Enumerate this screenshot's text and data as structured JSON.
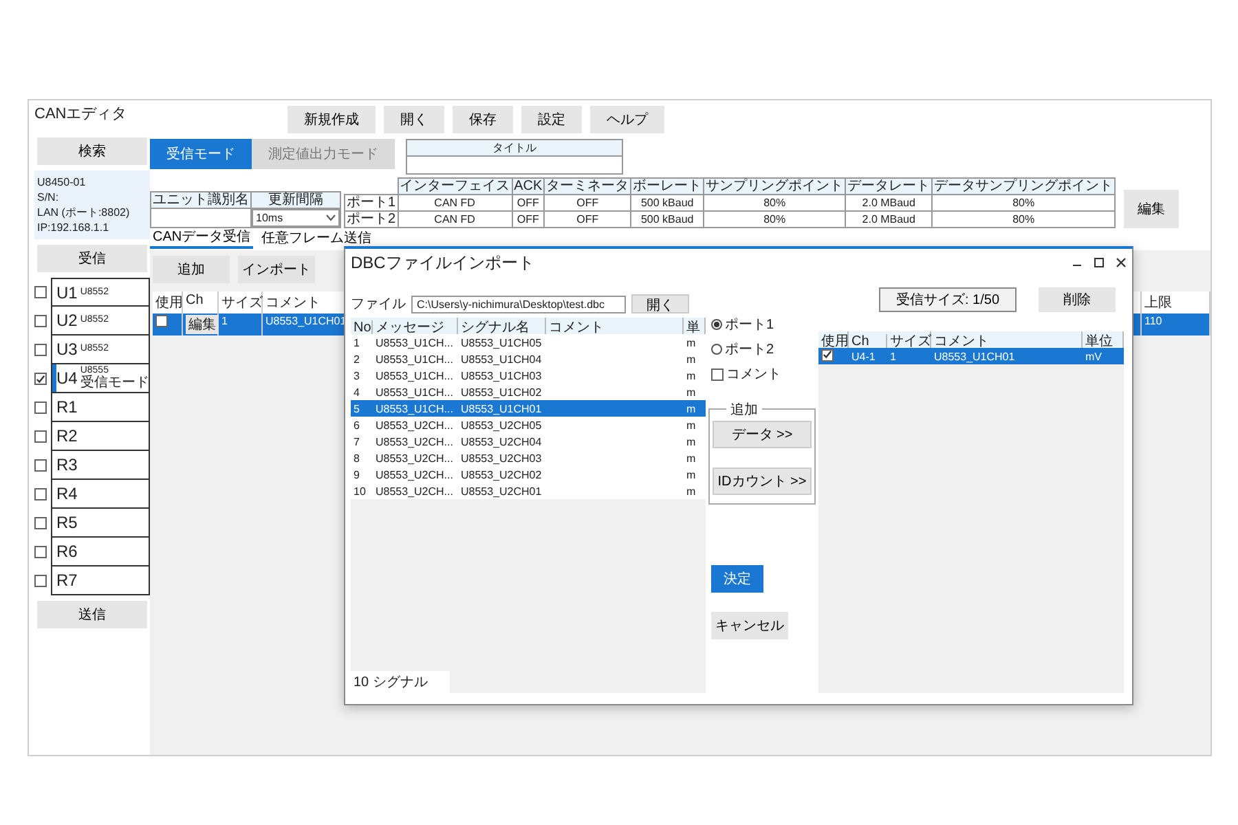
{
  "app": {
    "title": "CANエディタ"
  },
  "sidebar": {
    "search_button": "検索",
    "device_info": [
      "U8450-01",
      "S/N:",
      "LAN (ポート:8802)",
      "IP:192.168.1.1"
    ],
    "receive_button": "受信",
    "units": [
      {
        "name": "U1",
        "model": "U8552",
        "checked": false,
        "selected": false
      },
      {
        "name": "U2",
        "model": "U8552",
        "checked": false,
        "selected": false
      },
      {
        "name": "U3",
        "model": "U8552",
        "checked": false,
        "selected": false
      },
      {
        "name": "U4",
        "model": "U8555",
        "mode": "受信モード",
        "checked": true,
        "selected": true
      },
      {
        "name": "R1",
        "checked": false,
        "selected": false
      },
      {
        "name": "R2",
        "checked": false,
        "selected": false
      },
      {
        "name": "R3",
        "checked": false,
        "selected": false
      },
      {
        "name": "R4",
        "checked": false,
        "selected": false
      },
      {
        "name": "R5",
        "checked": false,
        "selected": false
      },
      {
        "name": "R6",
        "checked": false,
        "selected": false
      },
      {
        "name": "R7",
        "checked": false,
        "selected": false
      }
    ],
    "send_button": "送信"
  },
  "toolbar": [
    "新規作成",
    "開く",
    "保存",
    "設定",
    "ヘルプ"
  ],
  "mode_tabs": [
    {
      "label": "受信モード",
      "selected": true
    },
    {
      "label": "測定値出力モード",
      "selected": false
    }
  ],
  "title_field": {
    "label": "タイトル"
  },
  "unit_settings": {
    "columns": [
      "ユニット識別名",
      "更新間隔"
    ],
    "interval": "10ms"
  },
  "ports": {
    "columns": [
      "インターフェイス",
      "ACK",
      "ターミネータ",
      "ボーレート",
      "サンプリングポイント",
      "データレート",
      "データサンプリングポイント"
    ],
    "rows": [
      {
        "port": "ポート1",
        "cells": [
          "CAN FD",
          "OFF",
          "OFF",
          "500 kBaud",
          "80%",
          "2.0 MBaud",
          "80%"
        ]
      },
      {
        "port": "ポート2",
        "cells": [
          "CAN FD",
          "OFF",
          "OFF",
          "500 kBaud",
          "80%",
          "2.0 MBaud",
          "80%"
        ]
      }
    ],
    "edit_button": "編集"
  },
  "data_tabs": [
    {
      "label": "CANデータ受信",
      "selected": true
    },
    {
      "label": "任意フレーム送信",
      "selected": false
    }
  ],
  "actions": [
    "追加",
    "インポート"
  ],
  "channel_table": {
    "columns": [
      "使用",
      "Ch",
      "サイズ",
      "コメント"
    ],
    "right_column": "上限",
    "rows": [
      {
        "used": false,
        "ch_button": "編集",
        "size": "1",
        "comment": "U8553_U1CH01",
        "limit": "110",
        "selected": true
      }
    ]
  },
  "dialog": {
    "title": "DBCファイルインポート",
    "file_label": "ファイル",
    "file_path": "C:\\Users\\y-nichimura\\Desktop\\test.dbc",
    "open_button": "開く",
    "columns": [
      "No",
      "メッセージ",
      "シグナル名",
      "コメント",
      "単"
    ],
    "signals": [
      {
        "no": "1",
        "message": "U8553_U1CH...",
        "signal": "U8553_U1CH05",
        "unit": "m",
        "selected": false
      },
      {
        "no": "2",
        "message": "U8553_U1CH...",
        "signal": "U8553_U1CH04",
        "unit": "m",
        "selected": false
      },
      {
        "no": "3",
        "message": "U8553_U1CH...",
        "signal": "U8553_U1CH03",
        "unit": "m",
        "selected": false
      },
      {
        "no": "4",
        "message": "U8553_U1CH...",
        "signal": "U8553_U1CH02",
        "unit": "m",
        "selected": false
      },
      {
        "no": "5",
        "message": "U8553_U1CH...",
        "signal": "U8553_U1CH01",
        "unit": "m",
        "selected": true
      },
      {
        "no": "6",
        "message": "U8553_U2CH...",
        "signal": "U8553_U2CH05",
        "unit": "m",
        "selected": false
      },
      {
        "no": "7",
        "message": "U8553_U2CH...",
        "signal": "U8553_U2CH04",
        "unit": "m",
        "selected": false
      },
      {
        "no": "8",
        "message": "U8553_U2CH...",
        "signal": "U8553_U2CH03",
        "unit": "m",
        "selected": false
      },
      {
        "no": "9",
        "message": "U8553_U2CH...",
        "signal": "U8553_U2CH02",
        "unit": "m",
        "selected": false
      },
      {
        "no": "10",
        "message": "U8553_U2CH...",
        "signal": "U8553_U2CH01",
        "unit": "m",
        "selected": false
      }
    ],
    "signal_count": "10 シグナル",
    "ports": [
      {
        "label": "ポート1",
        "selected": true
      },
      {
        "label": "ポート2",
        "selected": false
      }
    ],
    "comment_option": {
      "label": "コメント",
      "checked": false
    },
    "add_group": {
      "title": "追加",
      "buttons": [
        "データ >>",
        "IDカウント >>"
      ]
    },
    "ok_button": "決定",
    "cancel_button": "キャンセル",
    "receive_size_button": "受信サイズ: 1/50",
    "delete_button": "削除",
    "selected_columns": [
      "使用",
      "Ch",
      "サイズ",
      "コメント",
      "単位"
    ],
    "selected_rows": [
      {
        "used": true,
        "ch": "U4-1",
        "size": "1",
        "comment": "U8553_U1CH01",
        "unit": "mV",
        "selected": true
      }
    ]
  }
}
